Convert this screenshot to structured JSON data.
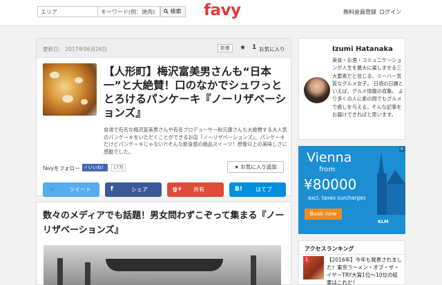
{
  "header": {
    "area_placeholder": "エリア",
    "keyword_placeholder": "キーワード(例：焼肉)",
    "search_button": "検索",
    "logo": "favy",
    "signup": "無料会員登録",
    "login": "ログイン"
  },
  "article": {
    "updated": "更新日： 2017年06月26日",
    "new_badge": "新着",
    "favorite_count": "1",
    "favorite_label": "お気に入り",
    "title": "【人形町】梅沢富美男さんも“日本一”と大絶賛！口のなかでシュワっととろけるパンケーキ『ノーリザベーションズ』",
    "description": "食通で有名な梅沢富美男さんや有名プロデューサー秋元康さんも大絶賛する大人気のパンケーキをいただくことができるお店『ノーリザベーションズ』。パンケーキだけどパンケーキじゃない?!そんな新食感の絶品スイーツ！想像以上の美味しさに感動でした。",
    "follow_label": "favyをフォロー",
    "like_label": "✓いいね！",
    "like_count": "17万",
    "add_favorite": "お気に入り追加",
    "share": {
      "twitter": "ツイート",
      "facebook": "シェア",
      "google": "共有",
      "hatena": "はてブ"
    }
  },
  "section": {
    "title": "数々のメディアでも話題！男女問わずこぞって集まる『ノーリザベーションズ』"
  },
  "profile": {
    "name": "Izumi Hatanaka",
    "bio": "美食・お酒・コミュニケーションが人生を最大に楽しませる三大要素だと信じる、ミーハー気質なグルメ女子。 日頃の日課といえば、グルメ情報の収集。 より多くの人に素の間でもグルメで癒しを与える。そんな記事をお届けできればと思います。"
  },
  "ad": {
    "city": "Vienna",
    "from": "from",
    "price": "¥80000",
    "note": "excl. taxes surcharges",
    "cta": "Book now",
    "brand": "KLM"
  },
  "ranking": {
    "title": "アクセスランキング",
    "items": [
      {
        "rank": "1",
        "text": "【2016年】今年も発表されました！東京ラーメン・オブ・ザ・イヤーTRY大賞1位〜10位の結果はこれだ！"
      }
    ]
  }
}
